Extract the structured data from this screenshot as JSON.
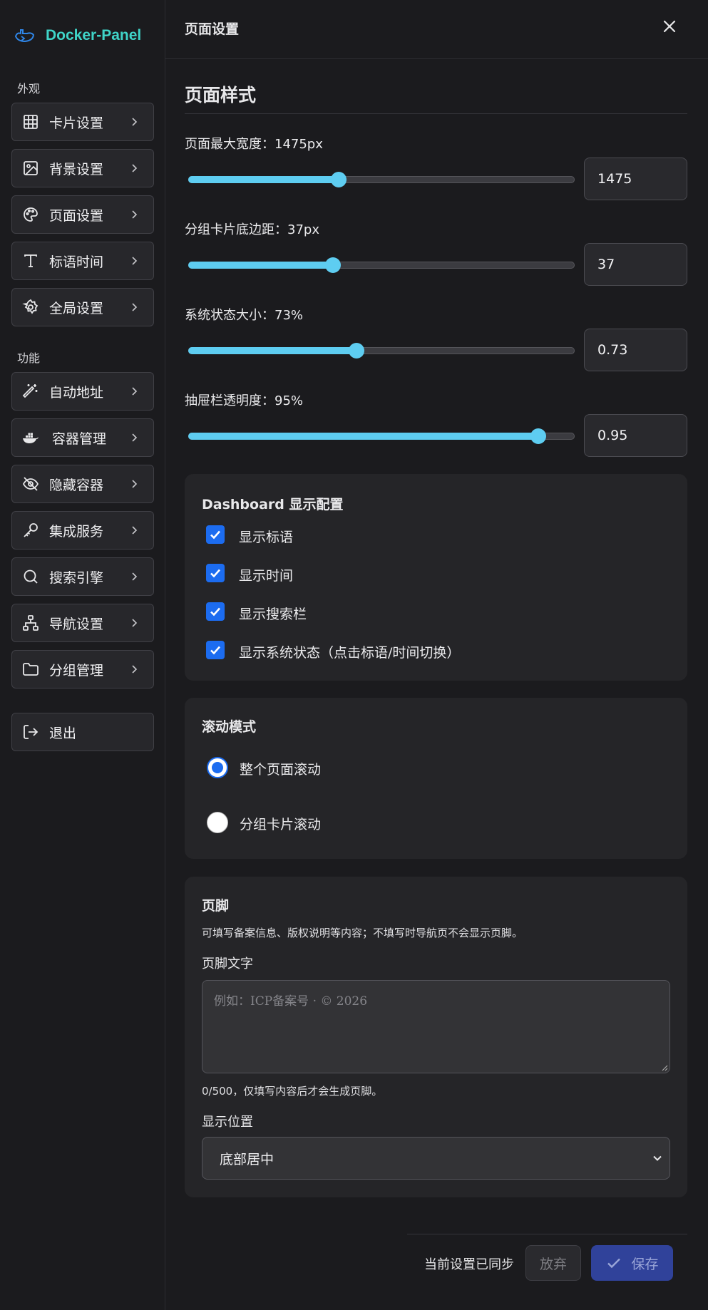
{
  "brand": {
    "name": "Docker-Panel"
  },
  "sidebar": {
    "sections": [
      {
        "label": "外观"
      },
      {
        "label": "功能"
      }
    ],
    "items": [
      {
        "label": "卡片设置",
        "icon": "grid-icon"
      },
      {
        "label": "背景设置",
        "icon": "image-icon"
      },
      {
        "label": "页面设置",
        "icon": "palette-icon"
      },
      {
        "label": "标语时间",
        "icon": "type-icon"
      },
      {
        "label": "全局设置",
        "icon": "gear-icon"
      },
      {
        "label": "自动地址",
        "icon": "magic-wand-icon"
      },
      {
        "label": "容器管理",
        "icon": "docker-icon"
      },
      {
        "label": "隐藏容器",
        "icon": "eye-off-icon"
      },
      {
        "label": "集成服务",
        "icon": "key-icon"
      },
      {
        "label": "搜索引擎",
        "icon": "search-icon"
      },
      {
        "label": "导航设置",
        "icon": "sitemap-icon"
      },
      {
        "label": "分组管理",
        "icon": "folder-icon"
      }
    ],
    "logout": {
      "label": "退出",
      "icon": "logout-icon"
    }
  },
  "panel": {
    "title": "页面设置",
    "section_title": "页面样式",
    "sliders": [
      {
        "label": "页面最大宽度：1475px",
        "value": "1475",
        "fraction": 0.39
      },
      {
        "label": "分组卡片底边距：37px",
        "value": "37",
        "fraction": 0.375
      },
      {
        "label": "系统状态大小：73%",
        "value": "0.73",
        "fraction": 0.435
      },
      {
        "label": "抽屉栏透明度：95%",
        "value": "0.95",
        "fraction": 0.905
      }
    ],
    "dashboard": {
      "title": "Dashboard 显示配置",
      "options": [
        {
          "label": "显示标语",
          "checked": true
        },
        {
          "label": "显示时间",
          "checked": true
        },
        {
          "label": "显示搜索栏",
          "checked": true
        },
        {
          "label": "显示系统状态（点击标语/时间切换）",
          "checked": true
        }
      ]
    },
    "scroll": {
      "title": "滚动模式",
      "options": [
        {
          "label": "整个页面滚动",
          "selected": true
        },
        {
          "label": "分组卡片滚动",
          "selected": false
        }
      ]
    },
    "footer": {
      "title": "页脚",
      "description": "可填写备案信息、版权说明等内容；不填写时导航页不会显示页脚。",
      "text_label": "页脚文字",
      "text_value": "",
      "text_placeholder": "例如：ICP备案号 · © 2026",
      "counter": "0/500，仅填写内容后才会生成页脚。",
      "position_label": "显示位置",
      "position_value": "底部居中"
    },
    "actions": {
      "status": "当前设置已同步",
      "discard": "放弃",
      "save": "保存"
    }
  },
  "colors": {
    "accent": "#5ecdf1",
    "checkbox": "#1c6cf0",
    "brand": "#3fd4c8",
    "save_button": "#30429a"
  }
}
